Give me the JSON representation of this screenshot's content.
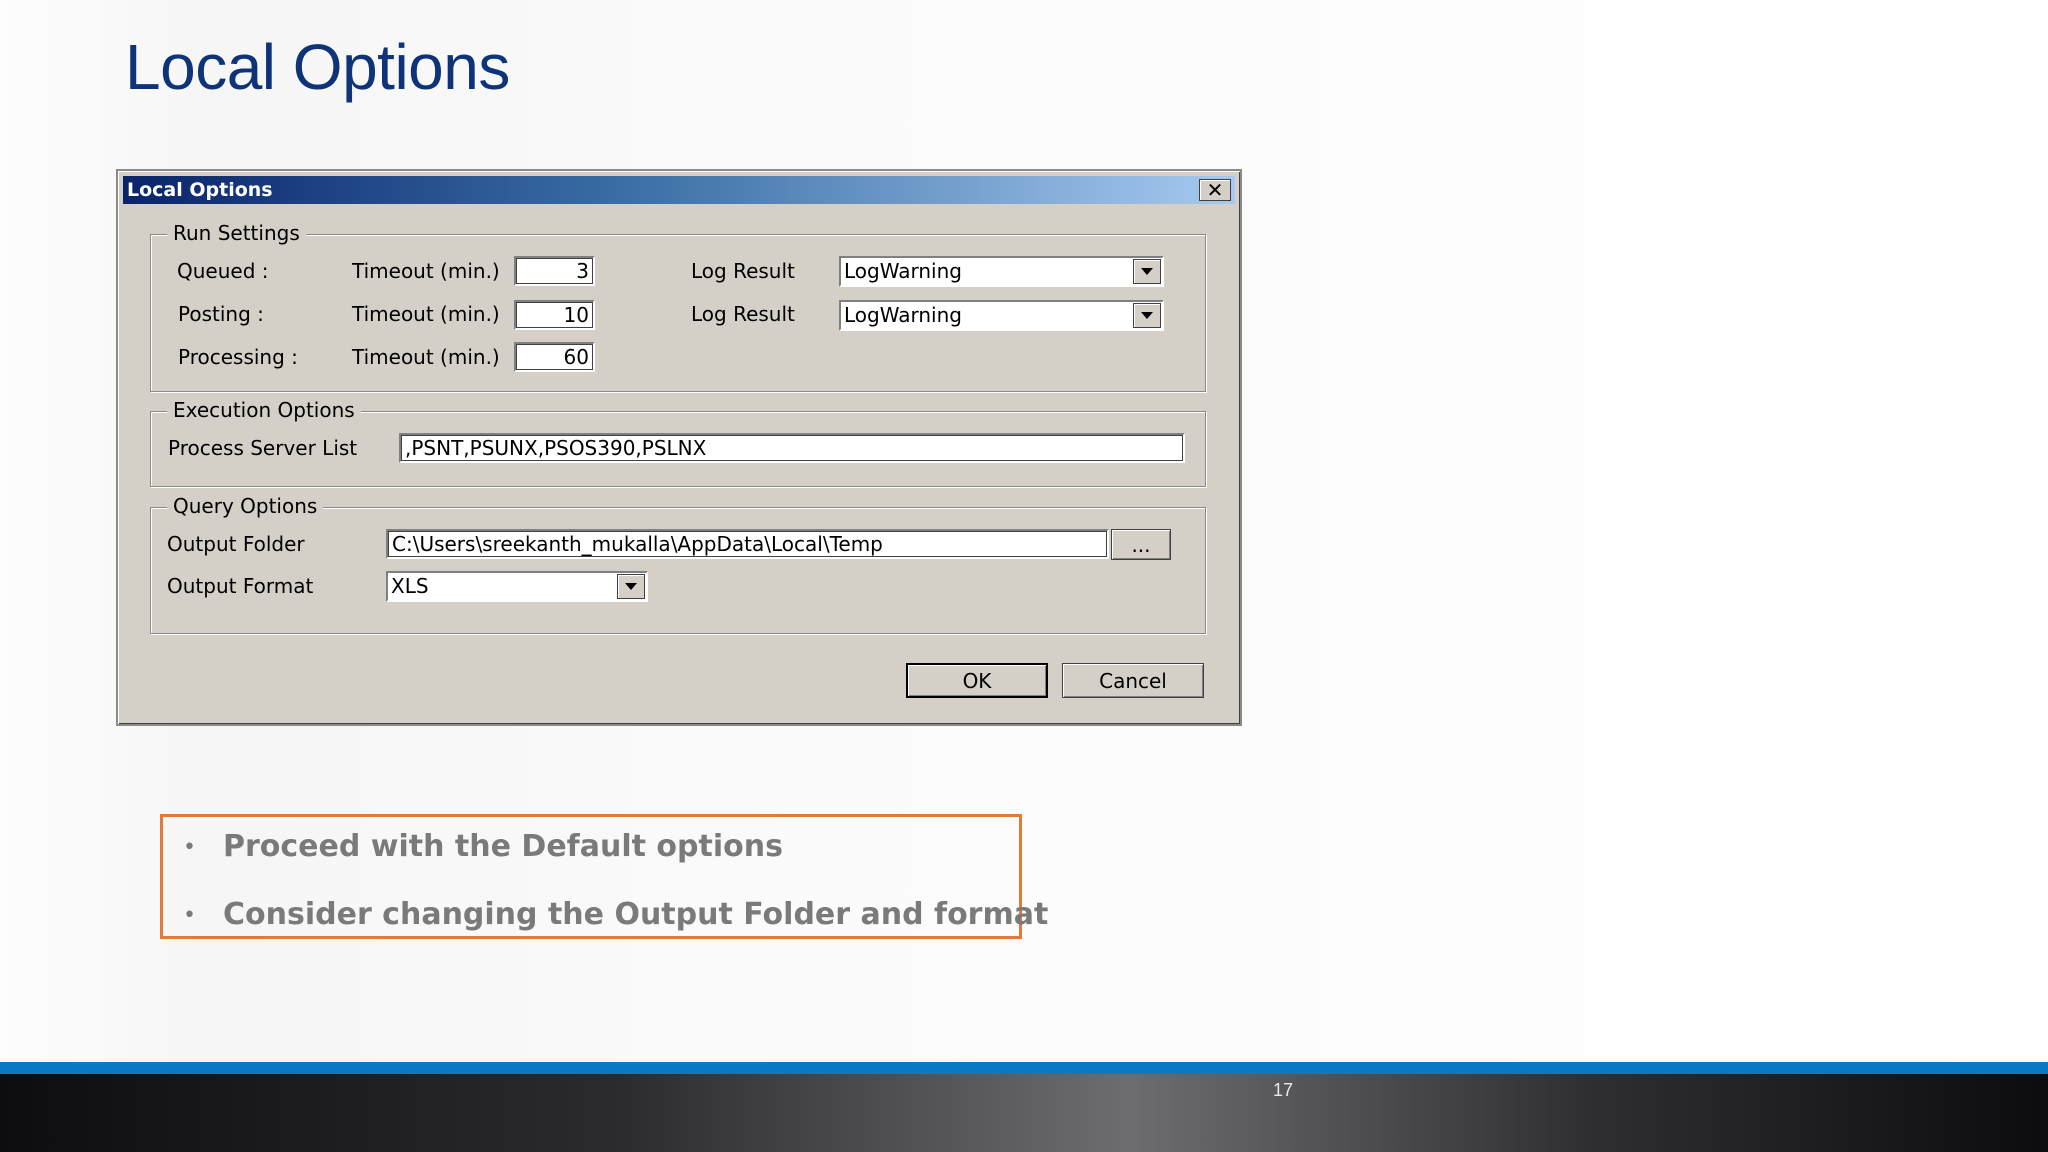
{
  "slide": {
    "title": "Local Options",
    "page_number": "17"
  },
  "dialog": {
    "title": "Local Options",
    "close_glyph": "✕",
    "run_settings": {
      "label": "Run Settings",
      "rows": [
        {
          "name": "Queued :",
          "timeout_label": "Timeout (min.)",
          "timeout_value": "3",
          "log_label": "Log Result",
          "log_value": "LogWarning"
        },
        {
          "name": "Posting :",
          "timeout_label": "Timeout (min.)",
          "timeout_value": "10",
          "log_label": "Log Result",
          "log_value": "LogWarning"
        },
        {
          "name": "Processing :",
          "timeout_label": "Timeout (min.)",
          "timeout_value": "60"
        }
      ]
    },
    "execution_options": {
      "label": "Execution Options",
      "process_server_label": "Process Server List",
      "process_server_value": ",PSNT,PSUNX,PSOS390,PSLNX"
    },
    "query_options": {
      "label": "Query Options",
      "output_folder_label": "Output Folder",
      "output_folder_value": "C:\\Users\\sreekanth_mukalla\\AppData\\Local\\Temp",
      "browse_label": "...",
      "output_format_label": "Output Format",
      "output_format_value": "XLS"
    },
    "ok_label": "OK",
    "cancel_label": "Cancel"
  },
  "notes": {
    "bullet_glyph": "•",
    "items": [
      "Proceed with the Default options",
      "Consider changing the Output Folder and format"
    ]
  },
  "colors": {
    "title": "#0e3378",
    "accent_stripe": "#0a7ac4",
    "notes_border": "#e07b39"
  }
}
